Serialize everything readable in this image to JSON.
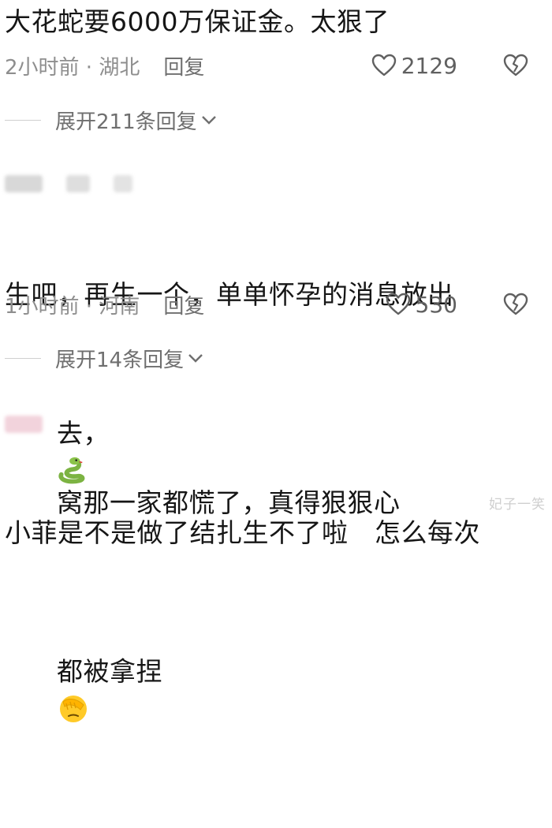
{
  "comments": [
    {
      "text": "大花蛇要6000万保证金。太狠了",
      "time": "2小时前 · 湖北",
      "reply": "回复",
      "likes": "2129",
      "expand": "展开211条回复"
    },
    {
      "text_line1": "生吧，再生一个，单单怀孕的消息放出",
      "text_line2a": "去，",
      "text_line2b": "窝那一家都慌了，真得狠狠心",
      "time": "1小时前 · 河南",
      "reply": "回复",
      "likes": "530",
      "expand": "展开14条回复",
      "inline_emoji": "snake-emoji"
    },
    {
      "text_line1": "小菲是不是做了结扎生不了啦　怎么每次",
      "text_line2": "都被拿捏",
      "inline_emoji": "facepalm-emoji"
    }
  ],
  "watermark": "妃子一笑",
  "colors": {
    "text": "#161616",
    "meta": "#8e8e8e",
    "blur_gray": "#d8d8d8",
    "blur_pink": "#f2d3dc"
  }
}
